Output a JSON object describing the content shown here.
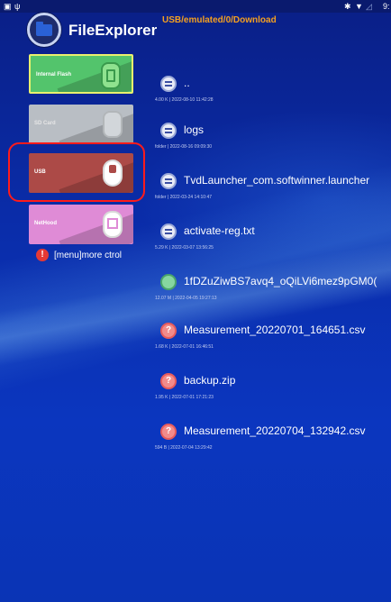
{
  "status_bar": {
    "left_icons": [
      "notification-icon",
      "usb-icon"
    ],
    "right_icons": [
      "bluetooth-icon",
      "wifi-icon",
      "signal-icon"
    ],
    "time": "9:"
  },
  "header": {
    "title": "FileExplorer",
    "path": "USB/emulated/0/Download"
  },
  "storage": [
    {
      "label": "Internal Flash",
      "icon": "chip-icon",
      "color": "#53c46c"
    },
    {
      "label": "SD Card",
      "icon": "sd-card-icon",
      "color": "#b9bec4"
    },
    {
      "label": "USB",
      "icon": "usb-drive-icon",
      "color": "#ac4a47"
    },
    {
      "label": "NetHood",
      "icon": "network-icon",
      "color": "#df8bd6"
    }
  ],
  "menu_hint": "[menu]more ctrol",
  "files": [
    {
      "name": "..",
      "meta": "4.00 K | 2022-08-10 11:42:28",
      "icon": "document-icon"
    },
    {
      "name": "logs",
      "meta": "folder | 2022-08-16 09:09:30",
      "icon": "document-icon"
    },
    {
      "name": "TvdLauncher_com.softwinner.launcher",
      "meta": "folder | 2022-03-24 14:10:47",
      "icon": "document-icon"
    },
    {
      "name": "activate-reg.txt",
      "meta": "5.29 K | 2022-03-07 13:56:25",
      "icon": "document-icon"
    },
    {
      "name": "1fDZuZiwBS7avq4_oQiLVi6mez9pGM0(",
      "meta": "12.07 M | 2022-04-05 19:27:13",
      "icon": "image-icon"
    },
    {
      "name": "Measurement_20220701_164651.csv",
      "meta": "1.68 K | 2022-07-01 16:46:51",
      "icon": "unknown-file-icon"
    },
    {
      "name": "backup.zip",
      "meta": "1.95 K | 2022-07-01 17:21:23",
      "icon": "unknown-file-icon"
    },
    {
      "name": "Measurement_20220704_132942.csv",
      "meta": "594 B | 2022-07-04 13:29:42",
      "icon": "unknown-file-icon"
    }
  ],
  "colors": {
    "accent_path": "#f4a020",
    "highlight": "#ff1b1b",
    "background": "#0b36bf"
  }
}
